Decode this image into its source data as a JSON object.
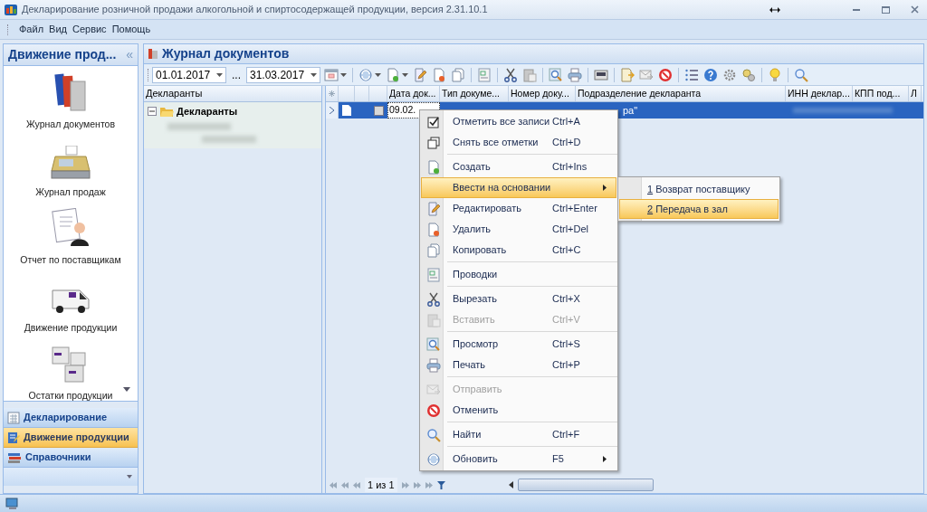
{
  "window": {
    "title": "Декларирование розничной продажи алкогольной и спиртосодержащей продукции, версия 2.31.10.1"
  },
  "menu_bar": [
    "Файл",
    "Вид",
    "Сервис",
    "Помощь"
  ],
  "sidebar": {
    "title": "Движение прод...",
    "collapse": "«",
    "items": [
      {
        "label": "Журнал документов"
      },
      {
        "label": "Журнал продаж"
      },
      {
        "label": "Отчет по поставщикам"
      },
      {
        "label": "Движение продукции"
      },
      {
        "label": "Остатки продукции"
      }
    ],
    "nav": [
      {
        "label": "Декларирование",
        "selected": false
      },
      {
        "label": "Движение продукции",
        "selected": true
      },
      {
        "label": "Справочники",
        "selected": false
      }
    ]
  },
  "document": {
    "title": "Журнал документов",
    "date_from": "01.01.2017",
    "range_sep": "...",
    "date_to": "31.03.2017"
  },
  "tree": {
    "header": "Декларанты",
    "root": {
      "label": "Декларанты",
      "expanded": true
    }
  },
  "grid": {
    "columns": [
      {
        "label": "Дата док..."
      },
      {
        "label": "Тип докуме..."
      },
      {
        "label": "Номер доку..."
      },
      {
        "label": "Подразделение декларанта"
      },
      {
        "label": "ИНН деклар..."
      },
      {
        "label": "КПП под..."
      },
      {
        "label": "Л"
      }
    ],
    "rows": [
      {
        "selected": true,
        "checked": false,
        "date": "09.02.",
        "division": "ра\""
      }
    ],
    "pager": "1 из 1"
  },
  "context_menu": [
    {
      "label": "Отметить все записи",
      "shortcut": "Ctrl+A",
      "disabled": false,
      "selected": false,
      "separator_before": false
    },
    {
      "label": "Снять все отметки",
      "shortcut": "Ctrl+D",
      "disabled": false,
      "selected": false,
      "separator_before": false
    },
    {
      "label": "Создать",
      "shortcut": "Ctrl+Ins",
      "disabled": false,
      "selected": false,
      "separator_before": true
    },
    {
      "label": "Ввести на основании",
      "disabled": false,
      "selected": true,
      "separator_before": false,
      "submenu": true
    },
    {
      "label": "Редактировать",
      "shortcut": "Ctrl+Enter",
      "disabled": false,
      "selected": false,
      "separator_before": false
    },
    {
      "label": "Удалить",
      "shortcut": "Ctrl+Del",
      "disabled": false,
      "selected": false,
      "separator_before": false
    },
    {
      "label": "Копировать",
      "shortcut": "Ctrl+C",
      "disabled": false,
      "selected": false,
      "separator_before": false
    },
    {
      "label": "Проводки",
      "disabled": false,
      "selected": false,
      "separator_before": true
    },
    {
      "label": "Вырезать",
      "shortcut": "Ctrl+X",
      "disabled": false,
      "selected": false,
      "separator_before": true
    },
    {
      "label": "Вставить",
      "shortcut": "Ctrl+V",
      "disabled": true,
      "selected": false,
      "separator_before": false
    },
    {
      "label": "Просмотр",
      "shortcut": "Ctrl+S",
      "disabled": false,
      "selected": false,
      "separator_before": true
    },
    {
      "label": "Печать",
      "shortcut": "Ctrl+P",
      "disabled": false,
      "selected": false,
      "separator_before": false
    },
    {
      "label": "Отправить",
      "disabled": true,
      "selected": false,
      "separator_before": true
    },
    {
      "label": "Отменить",
      "disabled": false,
      "selected": false,
      "separator_before": false
    },
    {
      "label": "Найти",
      "shortcut": "Ctrl+F",
      "disabled": false,
      "selected": false,
      "separator_before": true
    },
    {
      "label": "Обновить",
      "shortcut": "F5",
      "disabled": false,
      "selected": false,
      "separator_before": true,
      "submenu": true
    }
  ],
  "submenu": [
    {
      "accel": "1",
      "label": "Возврат поставщику",
      "selected": false
    },
    {
      "accel": "2",
      "label": "Передача в зал",
      "selected": true
    }
  ]
}
